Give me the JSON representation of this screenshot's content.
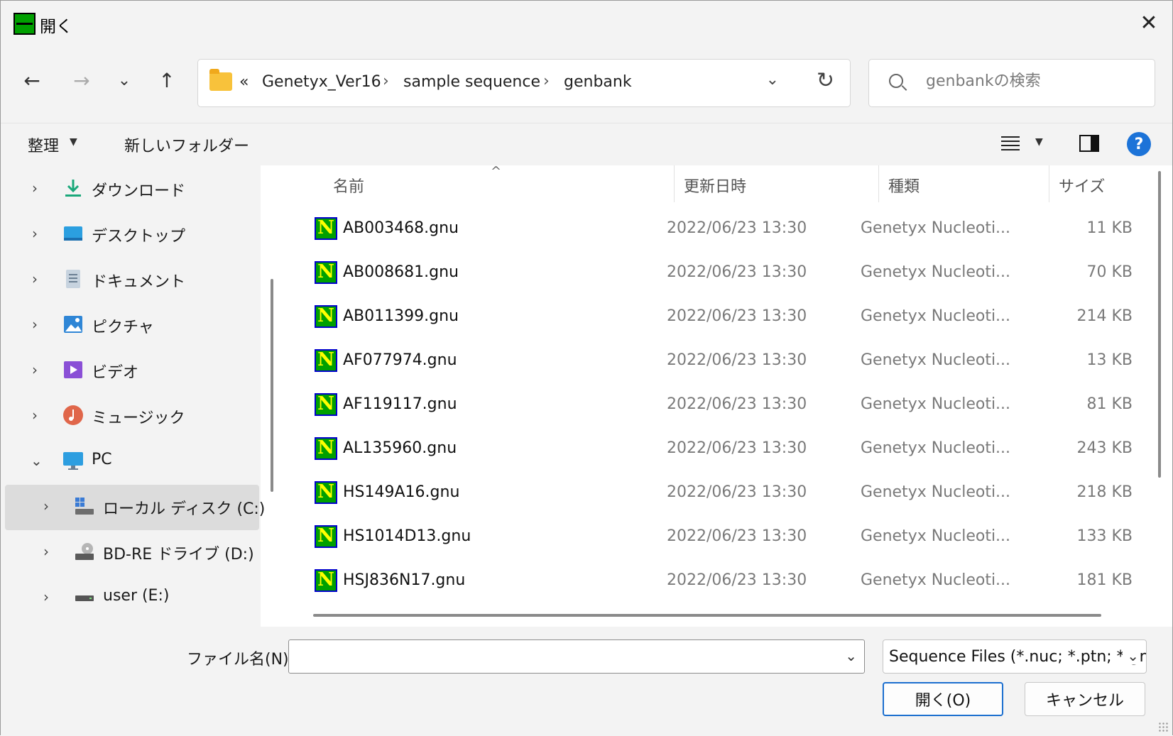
{
  "window": {
    "title": "開く",
    "close_symbol": "✕"
  },
  "nav": {
    "back": "←",
    "forward": "→",
    "recent": "⌄",
    "up": "↑",
    "breadcrumb": {
      "overflow": "«",
      "items": [
        "Genetyx_Ver16",
        "sample sequence",
        "genbank"
      ],
      "separator": "›"
    },
    "dropdown": "⌄",
    "refresh": "↻",
    "search_placeholder": "genbankの検索"
  },
  "toolbar": {
    "organize": "整理",
    "new_folder": "新しいフォルダー",
    "help": "?"
  },
  "sidebar": {
    "items": [
      {
        "label": "ダウンロード",
        "chevron": "›",
        "icon": "download-icon",
        "color": "#1aa87a"
      },
      {
        "label": "デスクトップ",
        "chevron": "›",
        "icon": "desktop-icon",
        "color": "#2b9fe0"
      },
      {
        "label": "ドキュメント",
        "chevron": "›",
        "icon": "documents-icon",
        "color": "#8fa3b8"
      },
      {
        "label": "ピクチャ",
        "chevron": "›",
        "icon": "pictures-icon",
        "color": "#2f86d6"
      },
      {
        "label": "ビデオ",
        "chevron": "›",
        "icon": "videos-icon",
        "color": "#8a4fd6"
      },
      {
        "label": "ミュージック",
        "chevron": "›",
        "icon": "music-icon",
        "color": "#e0664a"
      },
      {
        "label": "PC",
        "chevron": "⌄",
        "icon": "pc-icon",
        "color": "#2d9ee0"
      },
      {
        "label": "ローカル ディスク (C:)",
        "chevron": "›",
        "icon": "local-disk-icon",
        "color": "#3a7bd5"
      },
      {
        "label": "BD-RE ドライブ (D:)",
        "chevron": "›",
        "icon": "optical-drive-icon",
        "color": "#777777"
      },
      {
        "label": "user (E:)",
        "chevron": "›",
        "icon": "drive-icon",
        "color": "#555555"
      }
    ]
  },
  "files": {
    "columns": {
      "name": "名前",
      "modified": "更新日時",
      "type": "種類",
      "size": "サイズ"
    },
    "sort_indicator": "^",
    "rows": [
      {
        "icon": "N",
        "name": "AB003468.gnu",
        "modified": "2022/06/23 13:30",
        "type": "Genetyx Nucleoti...",
        "size": "11 KB"
      },
      {
        "icon": "N",
        "name": "AB008681.gnu",
        "modified": "2022/06/23 13:30",
        "type": "Genetyx Nucleoti...",
        "size": "70 KB"
      },
      {
        "icon": "N",
        "name": "AB011399.gnu",
        "modified": "2022/06/23 13:30",
        "type": "Genetyx Nucleoti...",
        "size": "214 KB"
      },
      {
        "icon": "N",
        "name": "AF077974.gnu",
        "modified": "2022/06/23 13:30",
        "type": "Genetyx Nucleoti...",
        "size": "13 KB"
      },
      {
        "icon": "N",
        "name": "AF119117.gnu",
        "modified": "2022/06/23 13:30",
        "type": "Genetyx Nucleoti...",
        "size": "81 KB"
      },
      {
        "icon": "N",
        "name": "AL135960.gnu",
        "modified": "2022/06/23 13:30",
        "type": "Genetyx Nucleoti...",
        "size": "243 KB"
      },
      {
        "icon": "N",
        "name": "HS149A16.gnu",
        "modified": "2022/06/23 13:30",
        "type": "Genetyx Nucleoti...",
        "size": "218 KB"
      },
      {
        "icon": "N",
        "name": "HS1014D13.gnu",
        "modified": "2022/06/23 13:30",
        "type": "Genetyx Nucleoti...",
        "size": "133 KB"
      },
      {
        "icon": "N",
        "name": "HSJ836N17.gnu",
        "modified": "2022/06/23 13:30",
        "type": "Genetyx Nucleoti...",
        "size": "181 KB"
      }
    ]
  },
  "footer": {
    "filename_label": "ファイル名(N):",
    "filename_value": "",
    "filename_dropdown": "⌄",
    "filetype": "Sequence Files (*.nuc; *.ptn; *.gnu)",
    "filetype_dropdown": "⌄",
    "open_button": "開く(O)",
    "cancel_button": "キャンセル"
  }
}
